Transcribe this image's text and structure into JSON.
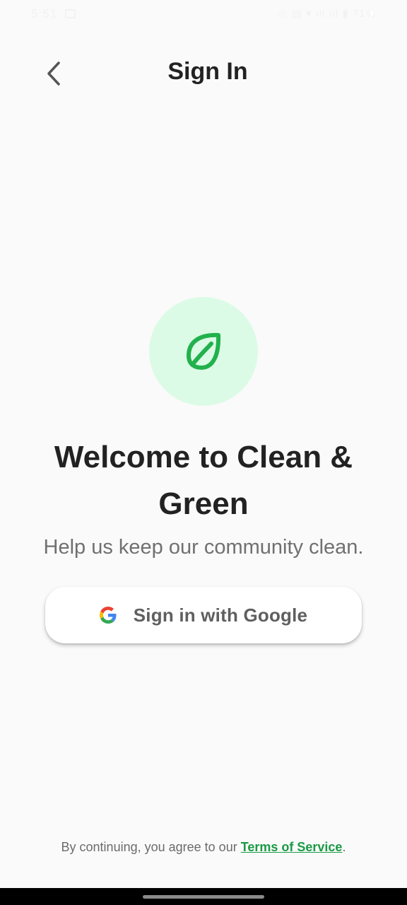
{
  "status_bar": {
    "time": "5:51",
    "right_indicators": "◎ ▤ ▾ ıll ıll ▮ 71%"
  },
  "app_bar": {
    "title": "Sign In",
    "back_icon": "chevron-left-icon"
  },
  "logo": {
    "icon": "leaf-icon",
    "circle_color": "#dcfbe6",
    "leaf_color": "#22b14c"
  },
  "welcome": {
    "title": "Welcome to Clean & Green",
    "subtitle": "Help us keep our community clean."
  },
  "google_button": {
    "label": "Sign in with Google",
    "icon": "google-g-icon"
  },
  "footer": {
    "prefix": "By continuing, you agree to our ",
    "link": "Terms of Service",
    "suffix": ".",
    "link_color": "#1a9a45"
  }
}
